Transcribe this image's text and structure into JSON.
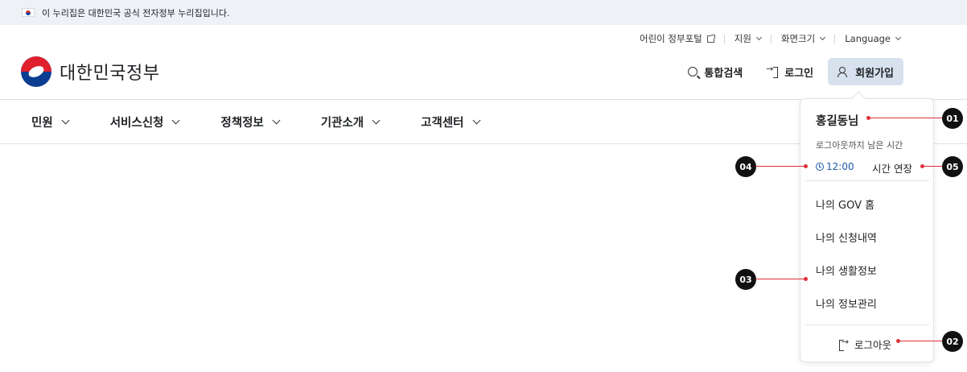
{
  "gov_banner": {
    "text": "이 누리집은 대한민국 공식 전자정부 누리집입니다."
  },
  "util_nav": {
    "kids_portal": "어린이 정부포털",
    "support": "지원",
    "font_size": "화면크기",
    "language": "Language"
  },
  "header": {
    "logo_text": "대한민국정부",
    "search": "통합검색",
    "login": "로그인",
    "signup": "회원가입"
  },
  "gnb": {
    "items": [
      {
        "label": "민원"
      },
      {
        "label": "서비스신청"
      },
      {
        "label": "정책정보"
      },
      {
        "label": "기관소개"
      },
      {
        "label": "고객센터"
      }
    ]
  },
  "user_panel": {
    "name": "홍길동님",
    "time_label": "로그아웃까지 남은 시간",
    "timer": "12:00",
    "extend": "시간 연장",
    "menu": [
      {
        "label": "나의 GOV 홈"
      },
      {
        "label": "나의 신청내역"
      },
      {
        "label": "나의 생활정보"
      },
      {
        "label": "나의 정보관리"
      }
    ],
    "logout": "로그아웃"
  },
  "callouts": {
    "c01": "01",
    "c02": "02",
    "c03": "03",
    "c04": "04",
    "c05": "05"
  },
  "colors": {
    "accent_red": "#e0303a",
    "link_blue": "#1c5aa8",
    "active_bg": "#d8e1ee",
    "banner_bg": "#eef1f6"
  }
}
